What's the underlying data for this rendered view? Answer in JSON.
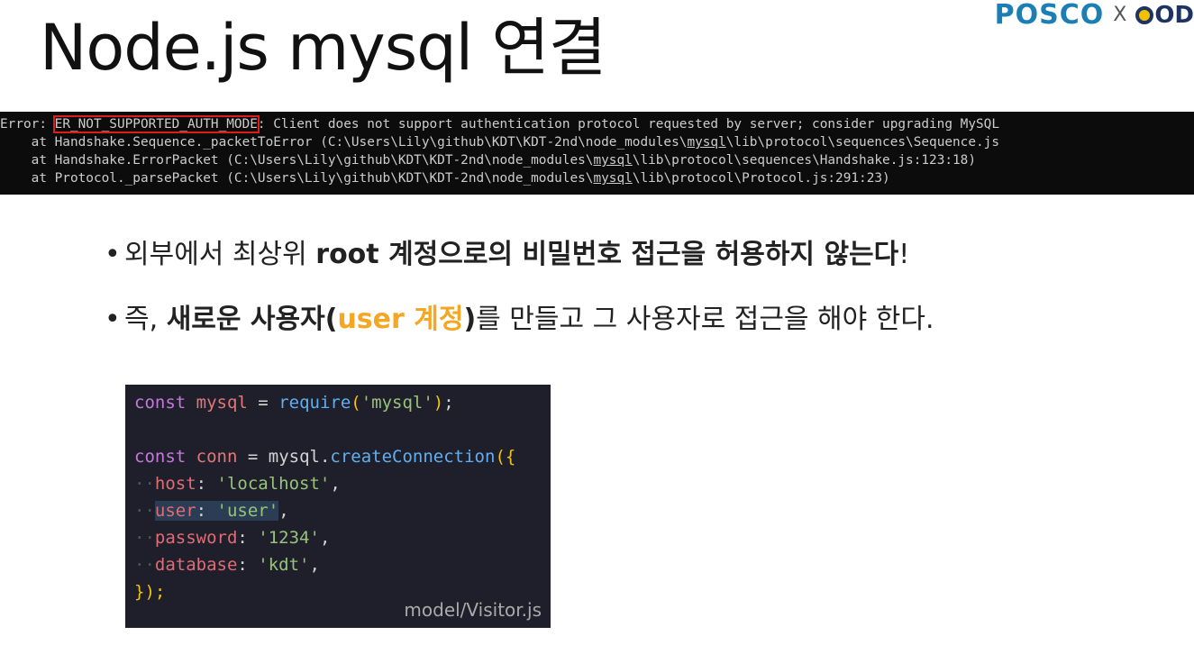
{
  "logo": {
    "posco": "POSCO",
    "x": "X",
    "cod": "OD"
  },
  "title": "Node.js mysql 연결",
  "terminal": {
    "line1_prefix": "Error: ",
    "line1_code": "ER_NOT_SUPPORTED_AUTH_MODE",
    "line1_rest": ": Client does not support authentication protocol requested by server; consider upgrading MySQL",
    "line2_a": "    at Handshake.Sequence._packetToError (C:\\Users\\Lily\\github\\KDT\\KDT-2nd\\node_modules\\",
    "line2_b": "mysql",
    "line2_c": "\\lib\\protocol\\sequences\\Sequence.js",
    "line3_a": "    at Handshake.ErrorPacket (C:\\Users\\Lily\\github\\KDT\\KDT-2nd\\node_modules\\",
    "line3_b": "mysql",
    "line3_c": "\\lib\\protocol\\sequences\\Handshake.js:123:18)",
    "line4_a": "    at Protocol._parsePacket (C:\\Users\\Lily\\github\\KDT\\KDT-2nd\\node_modules\\",
    "line4_b": "mysql",
    "line4_c": "\\lib\\protocol\\Protocol.js:291:23)"
  },
  "bullets": {
    "b1_plain": "외부에서 최상위 ",
    "b1_bold": "root 계정으로의 비밀번호 접근을 허용하지 않는다",
    "b1_end": "!",
    "b2_plain1": "즉, ",
    "b2_bold1": "새로운 사용자(",
    "b2_orange": "user 계정",
    "b2_bold2": ")",
    "b2_plain2": "를 만들고 그 사용자로 접근을 해야 한다."
  },
  "code": {
    "const": "const",
    "mysql_var": "mysql",
    "eq": " = ",
    "require": "require",
    "mysql_str": "'mysql'",
    "conn_var": "conn",
    "mysql_obj": "mysql",
    "create_conn": "createConnection",
    "host_key": "host",
    "host_val": "'localhost'",
    "user_key": "user",
    "user_val": "'user'",
    "password_key": "password",
    "password_val": "'1234'",
    "database_key": "database",
    "database_val": "'kdt'",
    "closing": "});",
    "filename": "model/Visitor.js"
  },
  "colors": {
    "logo_blue": "#1b7fb6",
    "logo_navy": "#1e3264",
    "highlight_orange": "#f5a623",
    "error_outline": "#e01b1b"
  }
}
